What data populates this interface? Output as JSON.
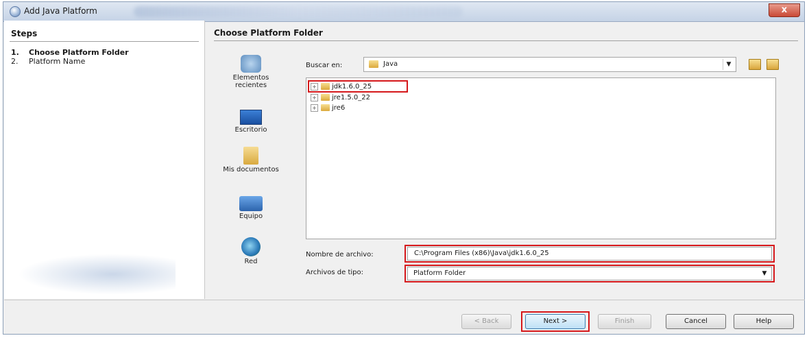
{
  "window": {
    "title": "Add Java Platform",
    "close_label": "x"
  },
  "steps": {
    "heading": "Steps",
    "items": [
      {
        "num": "1.",
        "label": "Choose Platform Folder"
      },
      {
        "num": "2.",
        "label": "Platform Name"
      }
    ]
  },
  "content": {
    "heading": "Choose Platform Folder"
  },
  "places": [
    {
      "label": "Elementos recientes",
      "icon": "recent-items-icon"
    },
    {
      "label": "Escritorio",
      "icon": "desktop-icon"
    },
    {
      "label": "Mis documentos",
      "icon": "documents-icon"
    },
    {
      "label": "Equipo",
      "icon": "computer-icon"
    },
    {
      "label": "Red",
      "icon": "network-icon"
    }
  ],
  "lookin": {
    "label": "Buscar en:",
    "value": "Java"
  },
  "files": [
    {
      "expander": "+",
      "name": "jdk1.6.0_25"
    },
    {
      "expander": "+",
      "name": "jre1.5.0_22"
    },
    {
      "expander": "+",
      "name": "jre6"
    }
  ],
  "filename": {
    "label": "Nombre de archivo:",
    "value": "C:\\Program Files (x86)\\Java\\jdk1.6.0_25"
  },
  "filetype": {
    "label": "Archivos de tipo:",
    "value": "Platform Folder"
  },
  "buttons": {
    "back": "< Back",
    "next": "Next >",
    "finish": "Finish",
    "cancel": "Cancel",
    "help": "Help"
  },
  "colors": {
    "highlight": "#d5171a",
    "accent": "#3c7fb1"
  }
}
